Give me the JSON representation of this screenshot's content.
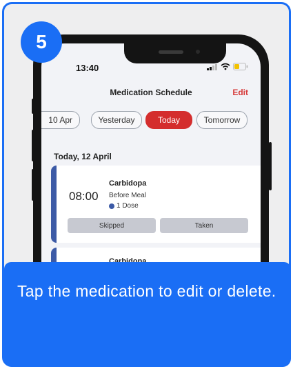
{
  "step": {
    "number": "5"
  },
  "status_bar": {
    "time": "13:40"
  },
  "header": {
    "title": "Medication Schedule",
    "edit_label": "Edit"
  },
  "date_chips": [
    {
      "label": "10 Apr",
      "selected": false
    },
    {
      "label": "Yesterday",
      "selected": false
    },
    {
      "label": "Today",
      "selected": true
    },
    {
      "label": "Tomorrow",
      "selected": false
    }
  ],
  "date_heading": "Today, 12 April",
  "medications": [
    {
      "time": "08:00",
      "name": "Carbidopa",
      "timing": "Before Meal",
      "dose": "1 Dose",
      "actions": {
        "skipped": "Skipped",
        "taken": "Taken"
      }
    },
    {
      "name": "Carbidopa"
    }
  ],
  "instruction": {
    "text": "Tap the medication to edit or delete."
  },
  "colors": {
    "accent_blue": "#1a6ef5",
    "today_red": "#d42d2d",
    "med_bar": "#3c5aa6",
    "edit_red": "#d63a3a"
  }
}
